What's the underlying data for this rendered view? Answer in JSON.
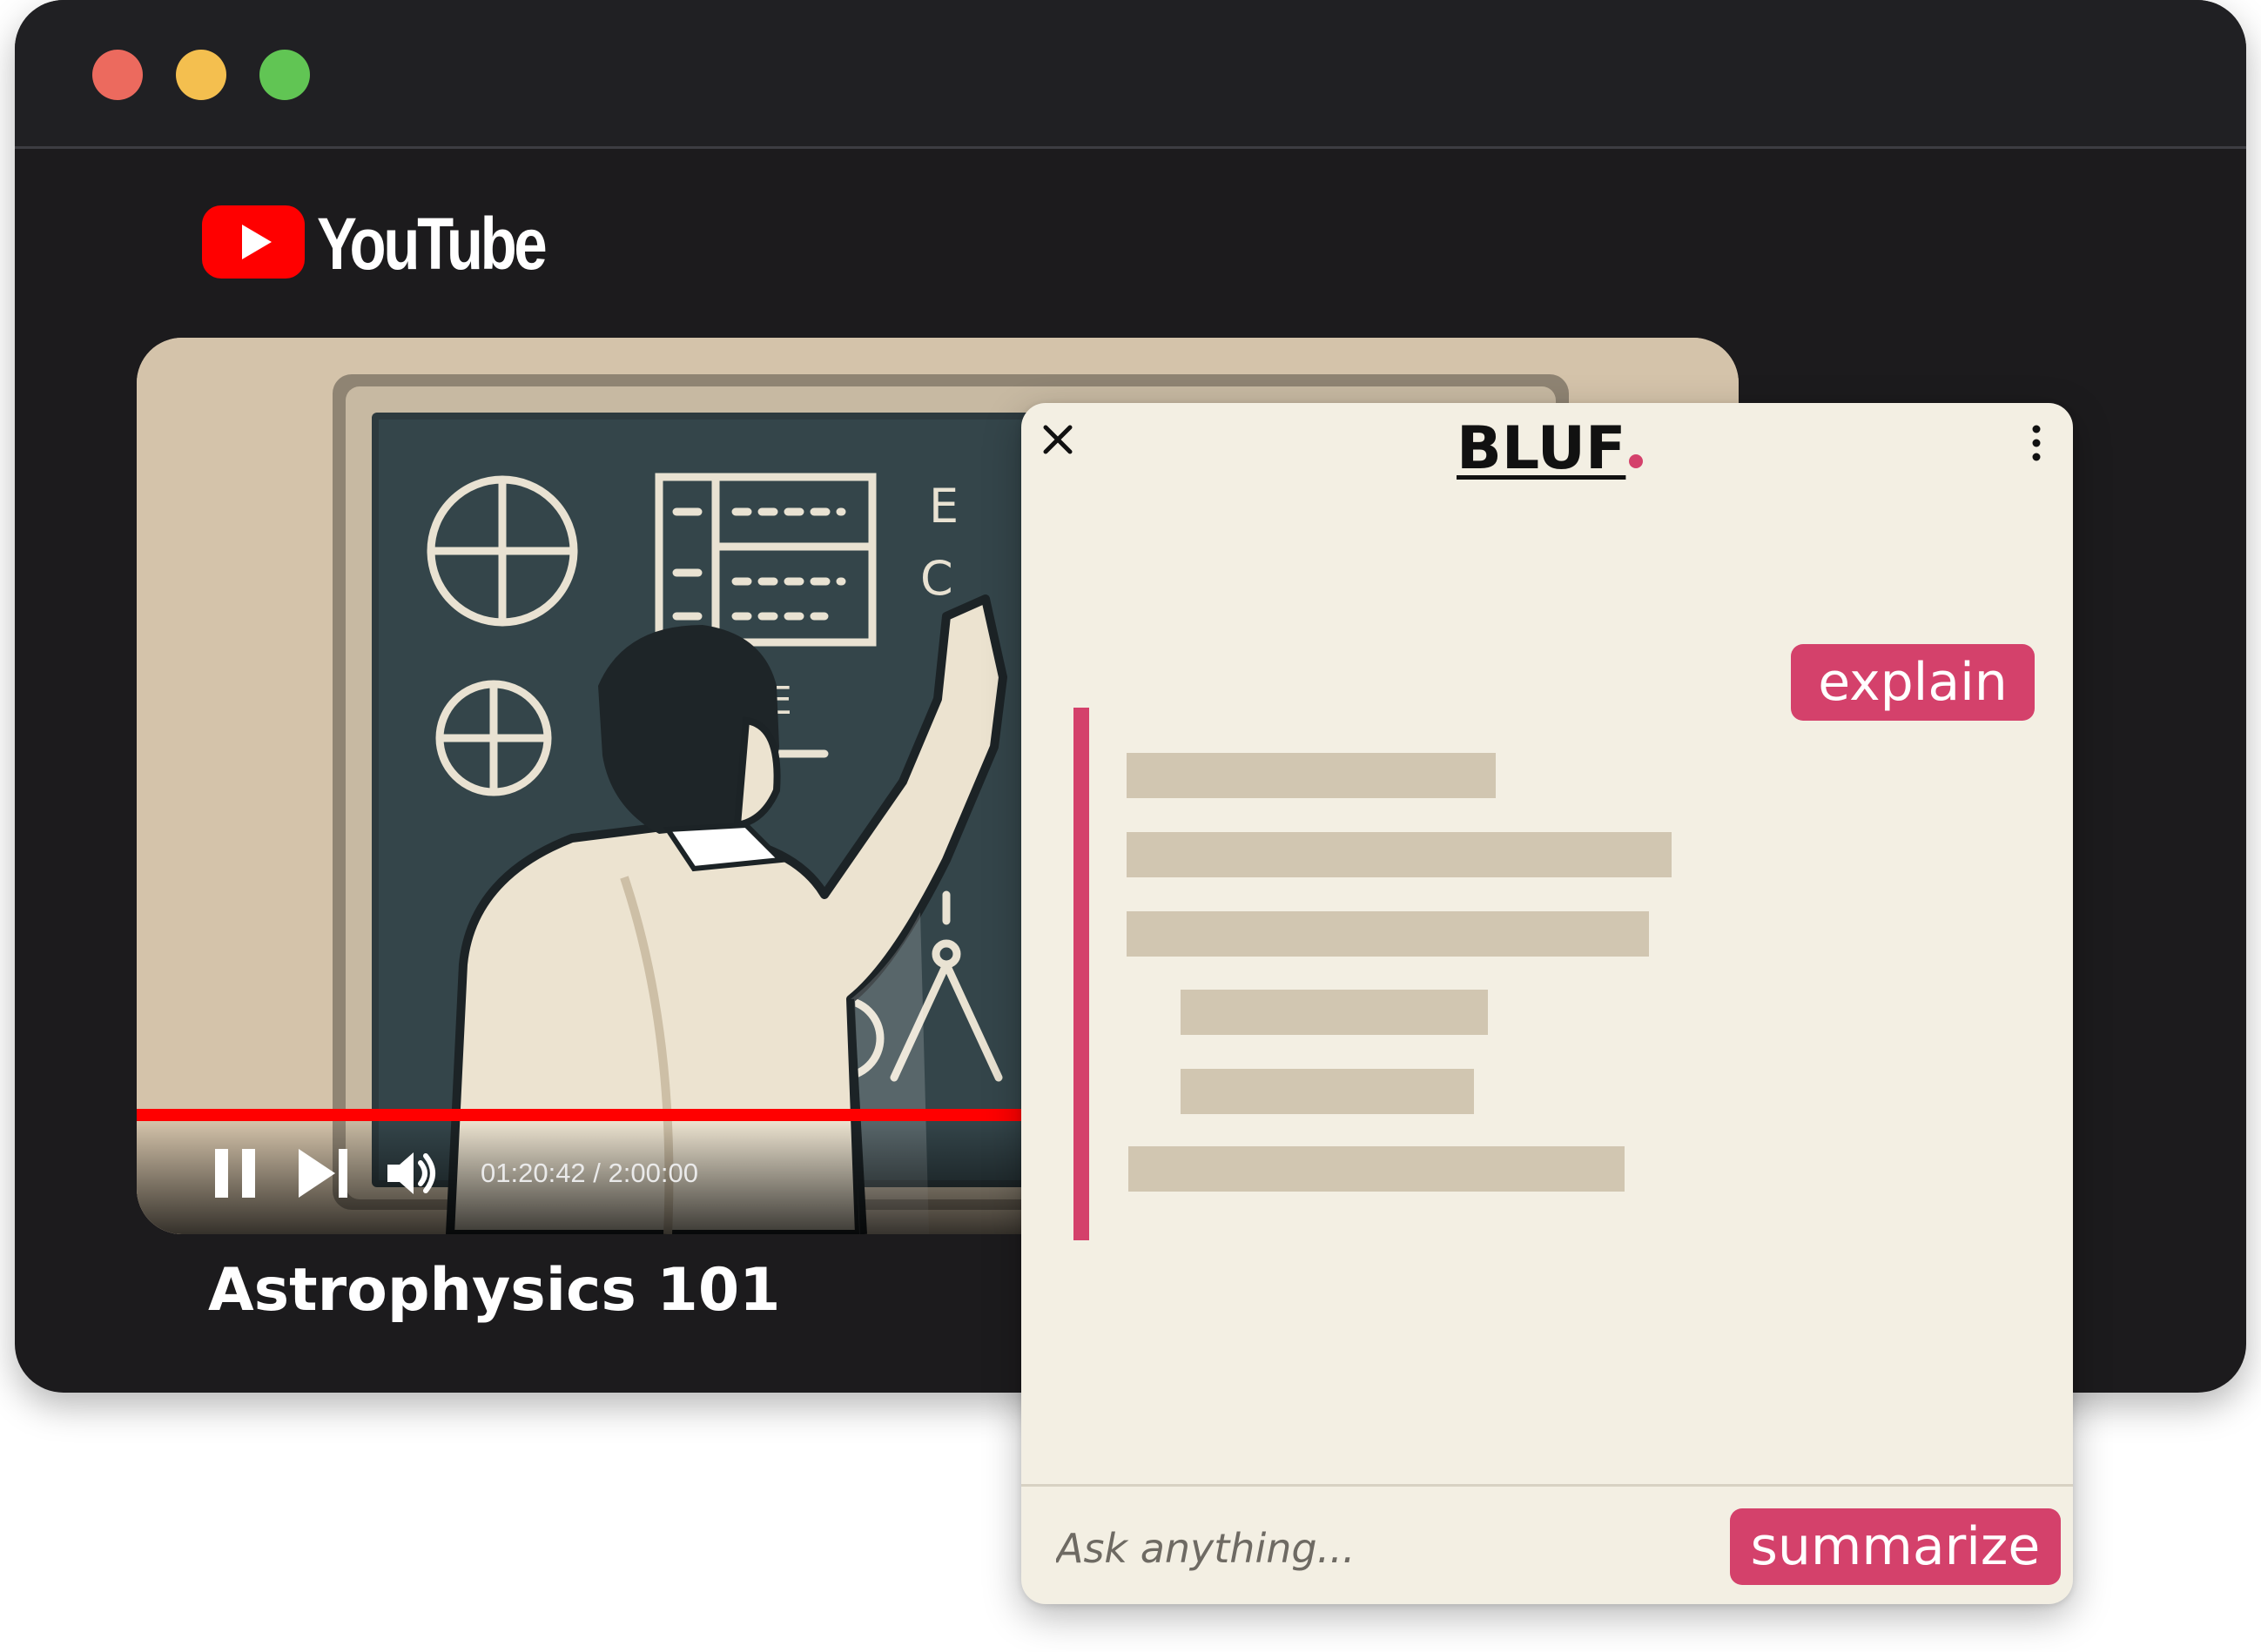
{
  "window": {
    "traffic_lights": {
      "close": "#ec6a5e",
      "minimize": "#f4bf4f",
      "maximize": "#61c554"
    }
  },
  "site": {
    "logo_text": "YouTube",
    "logo_icon": "youtube-play-icon",
    "brand_color": "#ff0000"
  },
  "video": {
    "title": "Astrophysics 101",
    "time_display": "01:20:42 / 2:00:00",
    "progress_fraction": 0.6725,
    "controls": {
      "pause_icon": "pause-icon",
      "next_icon": "skip-next-icon",
      "volume_icon": "volume-icon"
    }
  },
  "panel": {
    "brand": "BLUF",
    "accent_color": "#d4416b",
    "close_icon": "close-icon",
    "menu_icon": "more-vertical-icon",
    "explain_label": "explain",
    "summarize_label": "summarize",
    "ask_placeholder": "Ask anything..."
  }
}
